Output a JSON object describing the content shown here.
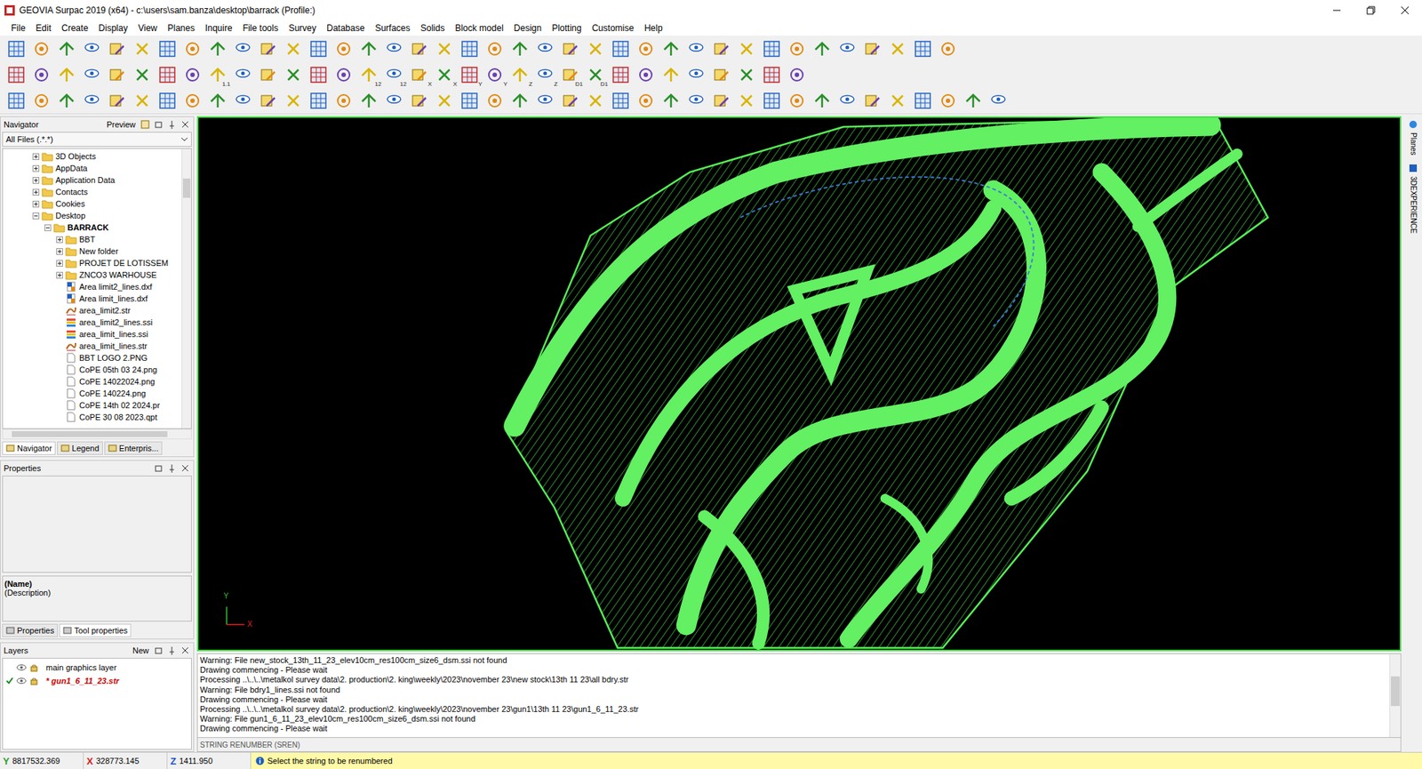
{
  "window": {
    "title": "GEOVIA Surpac 2019 (x64) - c:\\users\\sam.banza\\desktop\\barrack (Profile:)"
  },
  "menu": [
    "File",
    "Edit",
    "Create",
    "Display",
    "View",
    "Planes",
    "Inquire",
    "File tools",
    "Survey",
    "Database",
    "Surfaces",
    "Solids",
    "Block model",
    "Design",
    "Plotting",
    "Customise",
    "Help"
  ],
  "toolbars": [
    [
      "",
      "",
      "",
      "",
      "",
      "",
      "",
      "",
      "",
      "",
      "",
      "",
      "",
      "",
      "",
      "",
      "",
      "",
      "",
      "",
      "",
      "",
      "",
      "",
      "",
      "",
      "",
      "",
      "",
      "",
      "",
      "",
      "",
      "",
      "",
      "",
      "",
      ""
    ],
    [
      "",
      "",
      "",
      "",
      "",
      "",
      "",
      "",
      "1.1",
      "",
      "",
      "",
      "",
      "",
      "12",
      "12",
      "X",
      "X",
      "Y",
      "Y",
      "Z",
      "Z",
      "D1",
      "D1",
      "",
      "",
      "",
      "",
      "",
      "",
      "",
      ""
    ],
    [
      "",
      "",
      "",
      "",
      "",
      "",
      "",
      "",
      "",
      "",
      "",
      "",
      "",
      "",
      "",
      "",
      "",
      "",
      "",
      "",
      "",
      "",
      "",
      "",
      "",
      "",
      "",
      "",
      "",
      "",
      "",
      "",
      "",
      "",
      "",
      "",
      "",
      "",
      "",
      ""
    ]
  ],
  "navigator": {
    "title": "Navigator",
    "preview": "Preview",
    "filter": "All Files (.*.*)",
    "items": [
      {
        "label": "3D Objects",
        "level": 3,
        "kind": "folder",
        "expanded": false,
        "bold": false
      },
      {
        "label": "AppData",
        "level": 3,
        "kind": "folder",
        "expanded": false,
        "bold": false
      },
      {
        "label": "Application Data",
        "level": 3,
        "kind": "folder",
        "expanded": false,
        "bold": false
      },
      {
        "label": "Contacts",
        "level": 3,
        "kind": "folder",
        "expanded": false,
        "bold": false
      },
      {
        "label": "Cookies",
        "level": 3,
        "kind": "folder",
        "expanded": false,
        "bold": false
      },
      {
        "label": "Desktop",
        "level": 3,
        "kind": "folder",
        "expanded": true,
        "bold": false
      },
      {
        "label": "BARRACK",
        "level": 4,
        "kind": "folder",
        "expanded": true,
        "bold": true
      },
      {
        "label": "BBT",
        "level": 5,
        "kind": "folder",
        "expanded": false,
        "bold": false
      },
      {
        "label": "New folder",
        "level": 5,
        "kind": "folder",
        "expanded": false,
        "bold": false
      },
      {
        "label": "PROJET  DE LOTISSEM",
        "level": 5,
        "kind": "folder",
        "expanded": false,
        "bold": false
      },
      {
        "label": "ZNCO3 WARHOUSE",
        "level": 5,
        "kind": "folder",
        "expanded": false,
        "bold": false
      },
      {
        "label": "Area limit2_lines.dxf",
        "level": 5,
        "kind": "dxf",
        "expanded": false,
        "bold": false
      },
      {
        "label": "Area limit_lines.dxf",
        "level": 5,
        "kind": "dxf",
        "expanded": false,
        "bold": false
      },
      {
        "label": "area_limit2.str",
        "level": 5,
        "kind": "str",
        "expanded": false,
        "bold": false
      },
      {
        "label": "area_limit2_lines.ssi",
        "level": 5,
        "kind": "ssi",
        "expanded": false,
        "bold": false
      },
      {
        "label": "area_limit_lines.ssi",
        "level": 5,
        "kind": "ssi",
        "expanded": false,
        "bold": false
      },
      {
        "label": "area_limit_lines.str",
        "level": 5,
        "kind": "str",
        "expanded": false,
        "bold": false
      },
      {
        "label": "BBT LOGO 2.PNG",
        "level": 5,
        "kind": "image",
        "expanded": false,
        "bold": false
      },
      {
        "label": "CoPE 05th 03 24.png",
        "level": 5,
        "kind": "image",
        "expanded": false,
        "bold": false
      },
      {
        "label": "CoPE 14022024.png",
        "level": 5,
        "kind": "image",
        "expanded": false,
        "bold": false
      },
      {
        "label": "CoPE 140224.png",
        "level": 5,
        "kind": "image",
        "expanded": false,
        "bold": false
      },
      {
        "label": "CoPE 14th 02 2024.pr",
        "level": 5,
        "kind": "image",
        "expanded": false,
        "bold": false
      },
      {
        "label": "CoPE 30 08 2023.qpt",
        "level": 5,
        "kind": "image",
        "expanded": false,
        "bold": false
      }
    ],
    "tabs": [
      {
        "label": "Navigator",
        "selected": true
      },
      {
        "label": "Legend",
        "selected": false
      },
      {
        "label": "Enterpris...",
        "selected": false
      }
    ]
  },
  "properties": {
    "title": "Properties",
    "name": "(Name)",
    "description": "(Description)",
    "tabs": [
      {
        "label": "Properties",
        "selected": false
      },
      {
        "label": "Tool properties",
        "selected": true
      }
    ]
  },
  "layers": {
    "title": "Layers",
    "new": "New",
    "rows": [
      {
        "name": "main graphics layer",
        "checked": false,
        "active": false
      },
      {
        "name": "* gun1_6_11_23.str",
        "checked": true,
        "active": true
      }
    ]
  },
  "canvas": {
    "axis_y": "Y",
    "axis_x": "X"
  },
  "side_tabs": [
    "Planes",
    "3DEXPERIENCE"
  ],
  "messages": [
    "Warning: File new_stock_13th_11_23_elev10cm_res100cm_size6_dsm.ssi not found",
    "Drawing commencing - Please wait",
    "Processing ..\\..\\..\\metalkol survey data\\2. production\\2. king\\weekly\\2023\\november 23\\new stock\\13th 11 23\\all bdry.str",
    "Warning: File bdry1_lines.ssi not found",
    "Drawing commencing - Please wait",
    "Processing ..\\..\\..\\metalkol survey data\\2. production\\2. king\\weekly\\2023\\november 23\\gun1\\13th 11 23\\gun1_6_11_23.str",
    "Warning: File gun1_6_11_23_elev10cm_res100cm_size6_dsm.ssi not found",
    "Drawing commencing - Please wait"
  ],
  "command": "STRING RENUMBER (SREN)",
  "status": {
    "coords": [
      {
        "axis": "Y",
        "value": "8817532.369",
        "color": "#2e9e2e"
      },
      {
        "axis": "X",
        "value": "328773.145",
        "color": "#d42020"
      },
      {
        "axis": "Z",
        "value": "1411.950",
        "color": "#2050d0"
      }
    ],
    "prompt": "Select the string to be renumbered"
  }
}
